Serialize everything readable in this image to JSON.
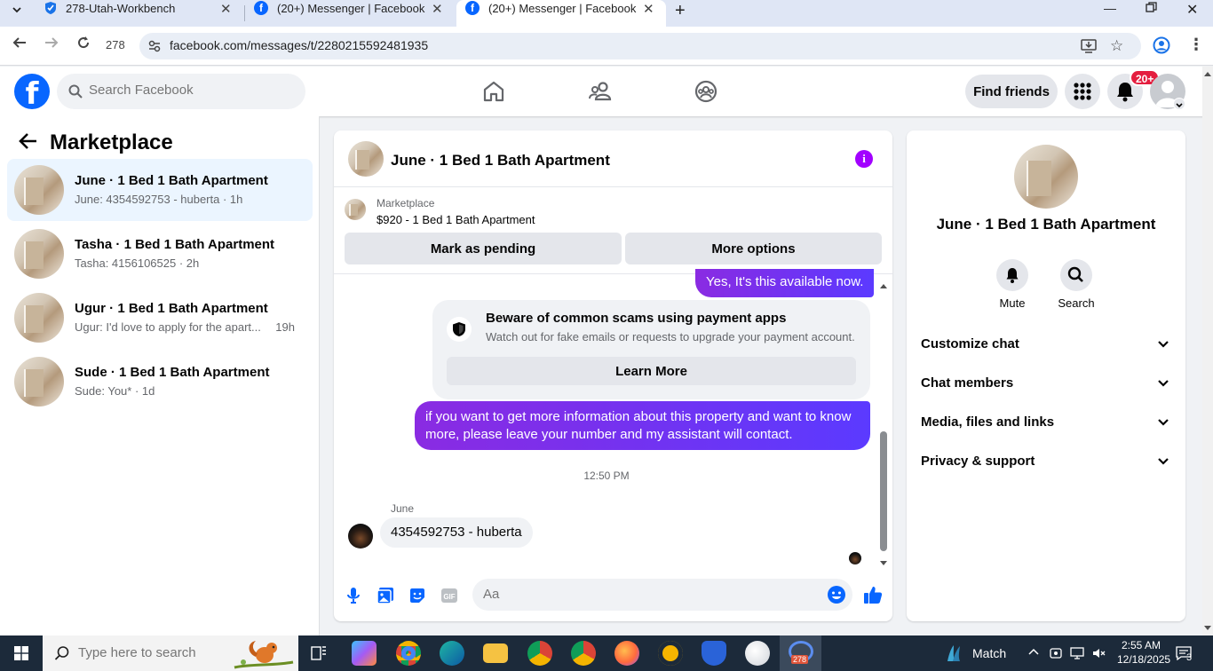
{
  "browser": {
    "tabs": [
      {
        "label": "278-Utah-Workbench",
        "active": false
      },
      {
        "label": "(20+) Messenger | Facebook",
        "active": false
      },
      {
        "label": "(20+) Messenger | Facebook",
        "active": true
      }
    ],
    "profile_count": "278",
    "url": "facebook.com/messages/t/2280215592481935"
  },
  "fb": {
    "search_placeholder": "Search Facebook",
    "find_friends": "Find friends",
    "notif_badge": "20+"
  },
  "sidebar": {
    "title": "Marketplace",
    "conversations": [
      {
        "title": "June · 1 Bed 1 Bath Apartment",
        "subtitle": "June: 4354592753 - huberta · 1h",
        "time": "",
        "active": true
      },
      {
        "title": "Tasha · 1 Bed 1 Bath Apartment",
        "subtitle": "Tasha: 4156106525 · 2h",
        "time": "",
        "active": false
      },
      {
        "title": "Ugur · 1 Bed 1 Bath Apartment",
        "subtitle": "Ugur: I'd love to apply for the apart...",
        "time": "19h",
        "active": false
      },
      {
        "title": "Sude · 1 Bed 1 Bath Apartment",
        "subtitle": "Sude: You* · 1d",
        "time": "",
        "active": false
      }
    ]
  },
  "chat": {
    "title": "June · 1 Bed 1 Bath Apartment",
    "marketplace_label": "Marketplace",
    "listing": "$920 - 1 Bed 1 Bath Apartment",
    "mark_pending": "Mark as pending",
    "more_options": "More options",
    "messages": {
      "out1": "Yes, It's this available now.",
      "scam_title": "Beware of common scams using payment apps",
      "scam_text": "Watch out for fake emails or requests to upgrade your payment account.",
      "learn_more": "Learn More",
      "out2": "if you want to get more information about this property and want to know more, please leave your number and my assistant will contact.",
      "timestamp": "12:50 PM",
      "sender": "June",
      "in1": "4354592753 - huberta"
    },
    "composer_placeholder": "Aa"
  },
  "info_panel": {
    "name": "June · 1 Bed 1 Bath Apartment",
    "actions": [
      "Mute",
      "Search"
    ],
    "sections": [
      "Customize chat",
      "Chat members",
      "Media, files and links",
      "Privacy & support"
    ]
  },
  "taskbar": {
    "search_placeholder": "Type here to search",
    "weather": "Match",
    "time": "2:55 AM",
    "date": "12/18/2025",
    "notif_count": "3",
    "active_badge": "278"
  },
  "colors": {
    "fb_blue": "#0866ff",
    "messenger_purple": "#a200ff",
    "bubble_gradient_start": "#8a2be2",
    "bubble_gradient_end": "#5b3aff",
    "notif_red": "#e41e3f"
  }
}
